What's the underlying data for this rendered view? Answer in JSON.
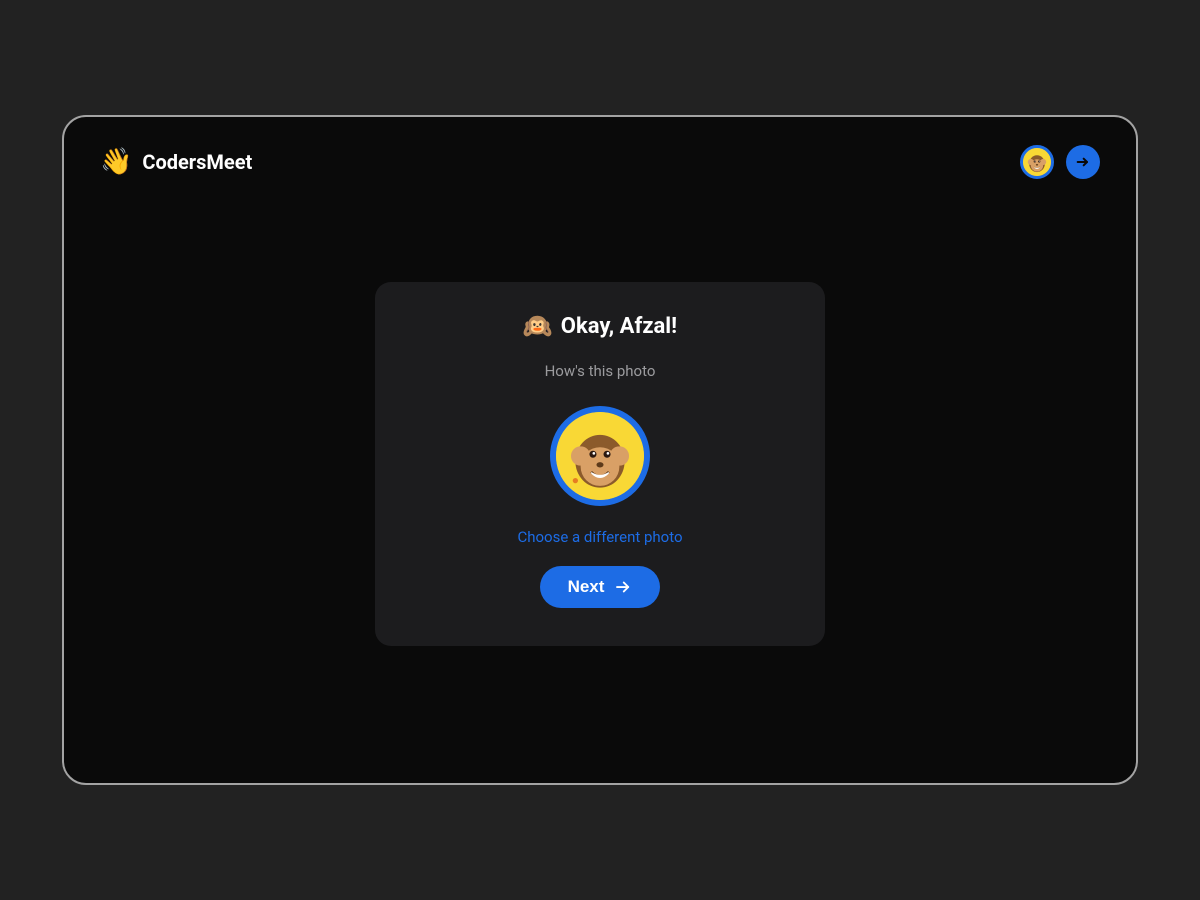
{
  "header": {
    "logo_icon": "👋",
    "logo_text": "CodersMeet"
  },
  "card": {
    "title_icon": "🙉",
    "title_text": "Okay, Afzal!",
    "subtitle": "How's this photo",
    "choose_link": "Choose a different photo",
    "next_button": "Next"
  },
  "colors": {
    "accent": "#1D6CE5",
    "background": "#222222",
    "window": "#0A0A0A",
    "card": "#1C1C1E"
  }
}
